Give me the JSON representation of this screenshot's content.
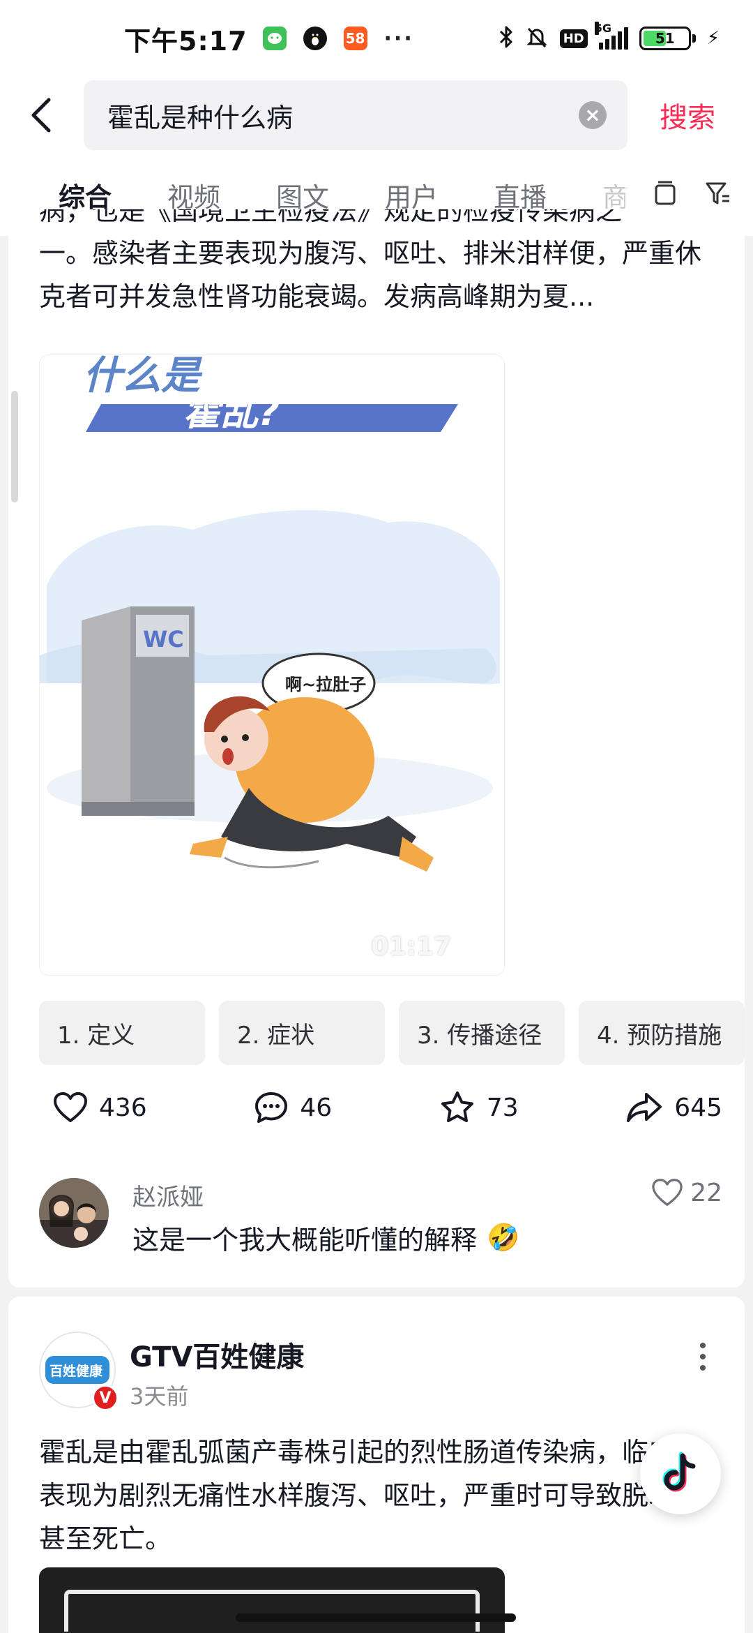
{
  "status_bar": {
    "time": "下午5:17",
    "notif_icons": [
      "wechat-icon",
      "qq-penguin-icon",
      "58-app-icon"
    ],
    "badge_58": "58",
    "more": "···",
    "net_hd": "HD",
    "net_type": "5G",
    "battery": "51",
    "battery_level": 0.51
  },
  "search": {
    "query": "霍乱是种什么病",
    "button": "搜索"
  },
  "tabs": {
    "items": [
      "综合",
      "视频",
      "图文",
      "用户",
      "直播"
    ],
    "cut": "商",
    "active_index": 0
  },
  "card1": {
    "desc_cut": "病，也是《国境卫生检疫法》规定的检疫传染病之",
    "desc": "一。感染者主要表现为腹泻、呕吐、排米泔样便，严重休克者可并发急性肾功能衰竭。发病高峰期为夏...",
    "video": {
      "title_line1": "什么是",
      "title_line2": "霍乱?",
      "wc_sign": "WC",
      "speech": "啊~拉肚子",
      "duration": "01:17"
    },
    "chapters": [
      "1. 定义",
      "2. 症状",
      "3. 传播途径",
      "4. 预防措施"
    ],
    "stats": {
      "likes": "436",
      "comments": "46",
      "favorites": "73",
      "shares": "645"
    },
    "comment": {
      "user": "赵派娅",
      "text": "这是一个我大概能听懂的解释",
      "emoji": "🤣",
      "likes": "22"
    }
  },
  "card2": {
    "author": "GTV百姓健康",
    "logo_text": "百姓健康",
    "verified": "V",
    "time": "3天前",
    "desc": "霍乱是由霍乱弧菌产毒株引起的烈性肠道传染病，临床表现为剧烈无痛性水样腹泻、呕吐，严重时可导致脱水甚至死亡。"
  },
  "colors": {
    "accent": "#fe2c55",
    "text": "#161823",
    "secondary": "#6f7178",
    "banner_blue": "#5874c8"
  }
}
